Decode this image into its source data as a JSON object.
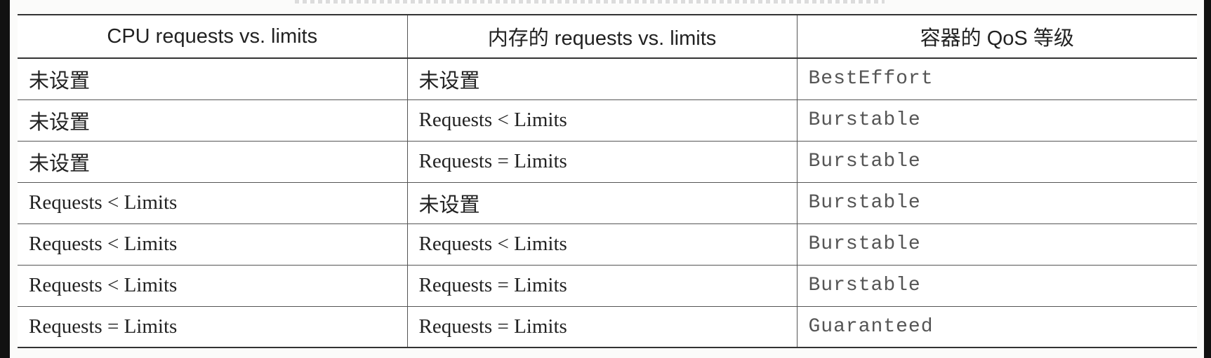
{
  "table": {
    "headers": {
      "cpu": "CPU requests vs. limits",
      "memory": "内存的 requests vs. limits",
      "qos": "容器的 QoS 等级"
    },
    "rows": [
      {
        "cpu": "未设置",
        "memory": "未设置",
        "qos": "BestEffort"
      },
      {
        "cpu": "未设置",
        "memory": "Requests < Limits",
        "qos": "Burstable"
      },
      {
        "cpu": "未设置",
        "memory": "Requests = Limits",
        "qos": "Burstable"
      },
      {
        "cpu": "Requests < Limits",
        "memory": "未设置",
        "qos": "Burstable"
      },
      {
        "cpu": "Requests < Limits",
        "memory": "Requests < Limits",
        "qos": "Burstable"
      },
      {
        "cpu": "Requests < Limits",
        "memory": "Requests = Limits",
        "qos": "Burstable"
      },
      {
        "cpu": "Requests = Limits",
        "memory": "Requests = Limits",
        "qos": "Guaranteed"
      }
    ]
  },
  "colors": {
    "border": "#555555",
    "text": "#222222",
    "mono_text": "#555555",
    "frame_bar": "#111111"
  }
}
